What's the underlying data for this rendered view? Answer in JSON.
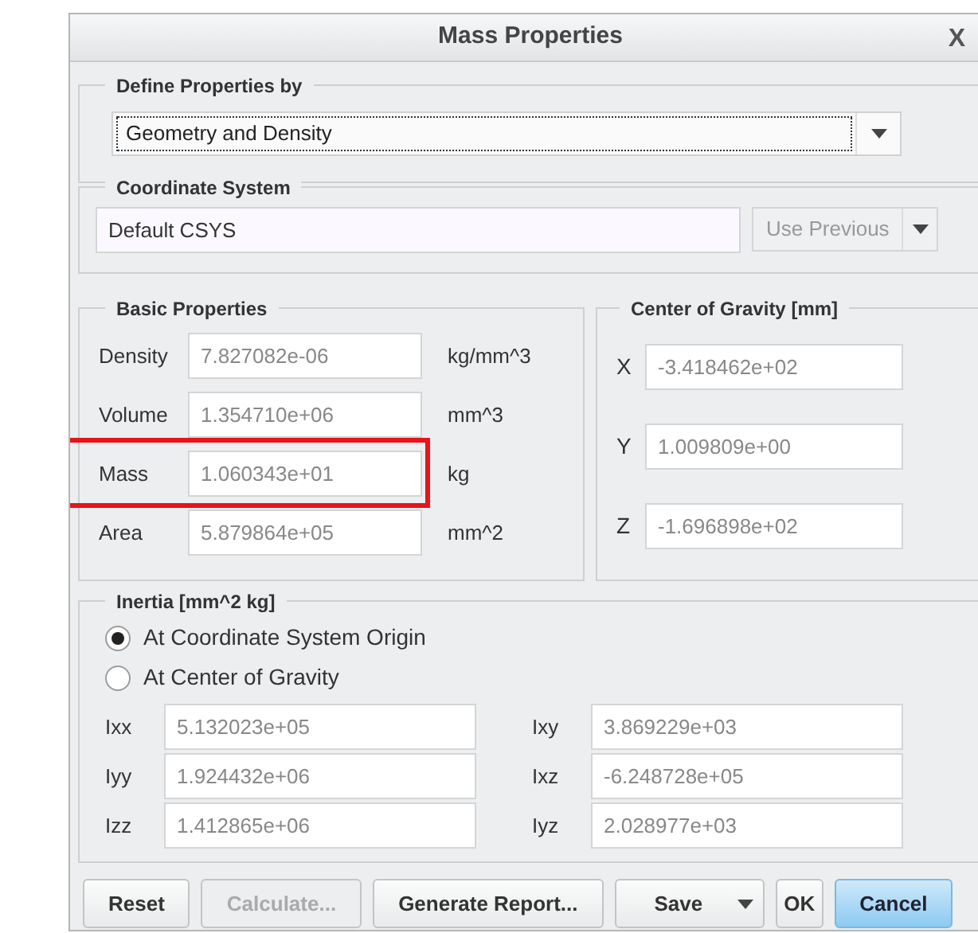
{
  "window": {
    "title": "Mass Properties",
    "close": "X"
  },
  "define_group": {
    "legend": "Define Properties by",
    "value": "Geometry and Density"
  },
  "coordinate_group": {
    "legend": "Coordinate System",
    "value": "Default CSYS",
    "button": {
      "label": "Use Previous",
      "disabled": true
    }
  },
  "basic_properties": {
    "legend": "Basic Properties",
    "rows": [
      {
        "label": "Density",
        "value": "7.827082e-06",
        "unit": "kg/mm^3",
        "highlighted": false
      },
      {
        "label": "Volume",
        "value": "1.354710e+06",
        "unit": "mm^3",
        "highlighted": false
      },
      {
        "label": "Mass",
        "value": "1.060343e+01",
        "unit": "kg",
        "highlighted": true
      },
      {
        "label": "Area",
        "value": "5.879864e+05",
        "unit": "mm^2",
        "highlighted": false
      }
    ]
  },
  "center_of_gravity": {
    "legend": "Center of Gravity [mm]",
    "rows": [
      {
        "label": "X",
        "value": "-3.418462e+02"
      },
      {
        "label": "Y",
        "value": "1.009809e+00"
      },
      {
        "label": "Z",
        "value": "-1.696898e+02"
      }
    ]
  },
  "inertia": {
    "legend": "Inertia [mm^2 kg]",
    "options": [
      {
        "label": "At Coordinate System Origin",
        "selected": true
      },
      {
        "label": "At Center of Gravity",
        "selected": false
      }
    ],
    "fields": [
      {
        "label": "Ixx",
        "value": "5.132023e+05"
      },
      {
        "label": "Ixy",
        "value": "3.869229e+03"
      },
      {
        "label": "Iyy",
        "value": "1.924432e+06"
      },
      {
        "label": "Ixz",
        "value": "-6.248728e+05"
      },
      {
        "label": "Izz",
        "value": "1.412865e+06"
      },
      {
        "label": "Iyz",
        "value": "2.028977e+03"
      }
    ]
  },
  "buttons": [
    {
      "label": "Reset",
      "kind": "plain",
      "disabled": false,
      "focused": false
    },
    {
      "label": "Calculate...",
      "kind": "plain",
      "disabled": true,
      "focused": false
    },
    {
      "label": "Generate Report...",
      "kind": "plain",
      "disabled": false,
      "focused": false
    },
    {
      "label": "Save",
      "kind": "split",
      "disabled": false,
      "focused": false
    },
    {
      "label": "OK",
      "kind": "plain",
      "disabled": false,
      "focused": false
    },
    {
      "label": "Cancel",
      "kind": "plain",
      "disabled": false,
      "focused": true
    }
  ]
}
